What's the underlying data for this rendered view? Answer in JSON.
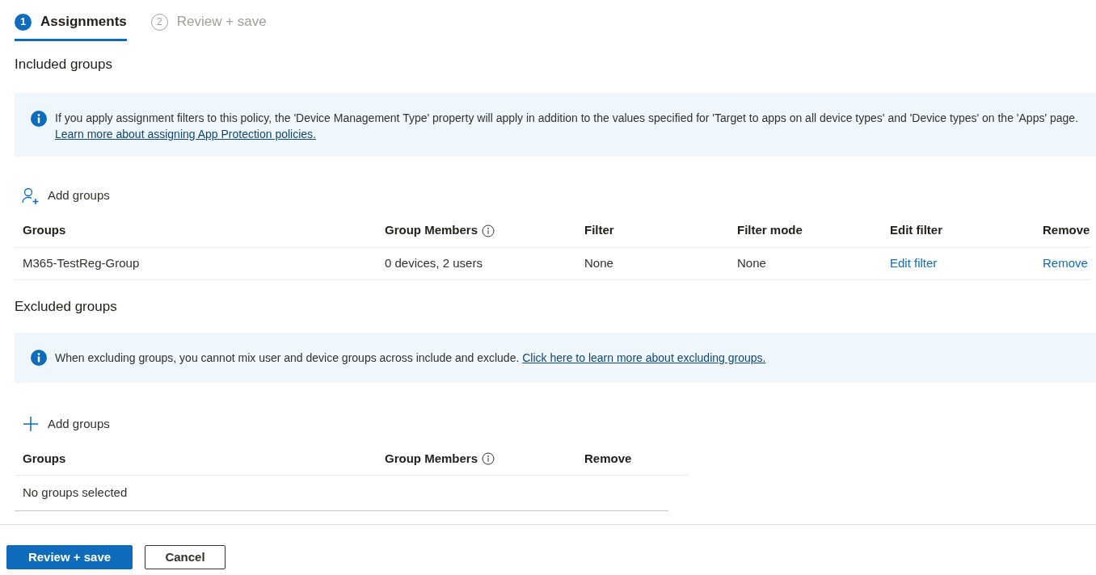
{
  "steps": [
    {
      "number": "1",
      "label": "Assignments",
      "selected": true
    },
    {
      "number": "2",
      "label": "Review + save",
      "selected": false
    }
  ],
  "included": {
    "heading": "Included groups",
    "info": {
      "text": "If you apply assignment filters to this policy, the 'Device Management Type' property will apply in addition to the values specified for 'Target to apps on all device types' and 'Device types' on the 'Apps' page.",
      "link": "Learn more about assigning App Protection policies."
    },
    "add_button": {
      "label": "Add groups",
      "kind": "person"
    },
    "table": {
      "columns": [
        {
          "label": "Groups",
          "info": false
        },
        {
          "label": "Group Members",
          "info": true
        },
        {
          "label": "Filter",
          "info": false
        },
        {
          "label": "Filter mode",
          "info": false
        },
        {
          "label": "Edit filter",
          "info": false
        },
        {
          "label": "Remove",
          "info": false
        }
      ],
      "rows": [
        {
          "cells": [
            {
              "text": "M365-TestReg-Group",
              "kind": "text"
            },
            {
              "text": "0 devices, 2 users",
              "kind": "text"
            },
            {
              "text": "None",
              "kind": "text"
            },
            {
              "text": "None",
              "kind": "text"
            },
            {
              "text": "Edit filter",
              "kind": "link"
            },
            {
              "text": "Remove",
              "kind": "link"
            }
          ]
        }
      ]
    }
  },
  "excluded": {
    "heading": "Excluded groups",
    "info": {
      "text": "When excluding groups, you cannot mix user and device groups across include and exclude.",
      "link": "Click here to learn more about excluding groups."
    },
    "add_button": {
      "label": "Add groups",
      "kind": "plus"
    },
    "table": {
      "columns": [
        {
          "label": "Groups",
          "info": false
        },
        {
          "label": "Group Members",
          "info": true
        },
        {
          "label": "Remove",
          "info": false
        }
      ],
      "empty_message": "No groups selected"
    }
  },
  "footer": {
    "buttons": [
      {
        "label": "Review + save",
        "kind": "primary"
      },
      {
        "label": "Cancel",
        "kind": "secondary"
      }
    ]
  }
}
